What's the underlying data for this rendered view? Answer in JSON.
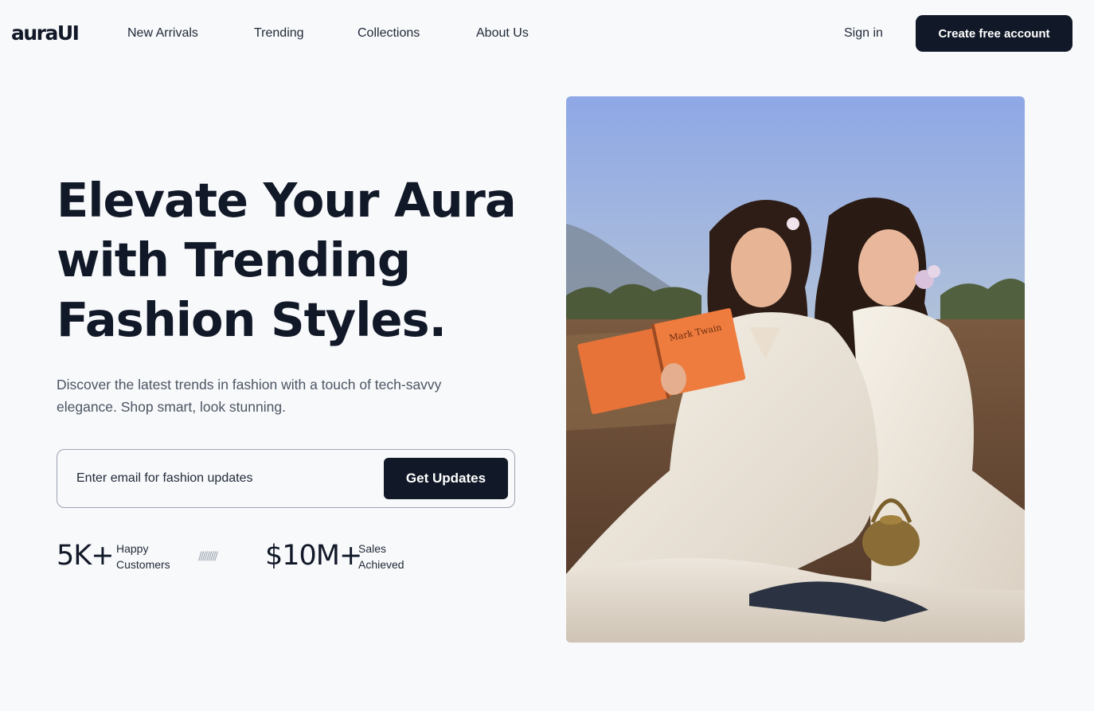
{
  "brand": {
    "logo": "auraUI"
  },
  "nav": {
    "links": [
      "New Arrivals",
      "Trending",
      "Collections",
      "About Us"
    ],
    "sign_in": "Sign in",
    "create_account": "Create free account"
  },
  "hero": {
    "headline_lines": [
      "Elevate Your Aura",
      "with Trending",
      "Fashion Styles."
    ],
    "subtext": "Discover the latest trends in fashion with a touch of tech-savvy elegance. Shop smart, look stunning.",
    "email": {
      "placeholder": "Enter email for fashion updates",
      "value": ""
    },
    "cta": "Get Updates",
    "divider": "/////////",
    "stats": [
      {
        "value": "5K+",
        "label_lines": [
          "Happy",
          "Customers"
        ]
      },
      {
        "value": "$10M+",
        "label_lines": [
          "Sales",
          "Achieved"
        ]
      }
    ],
    "image": {
      "book_text": "Mark Twain"
    }
  }
}
